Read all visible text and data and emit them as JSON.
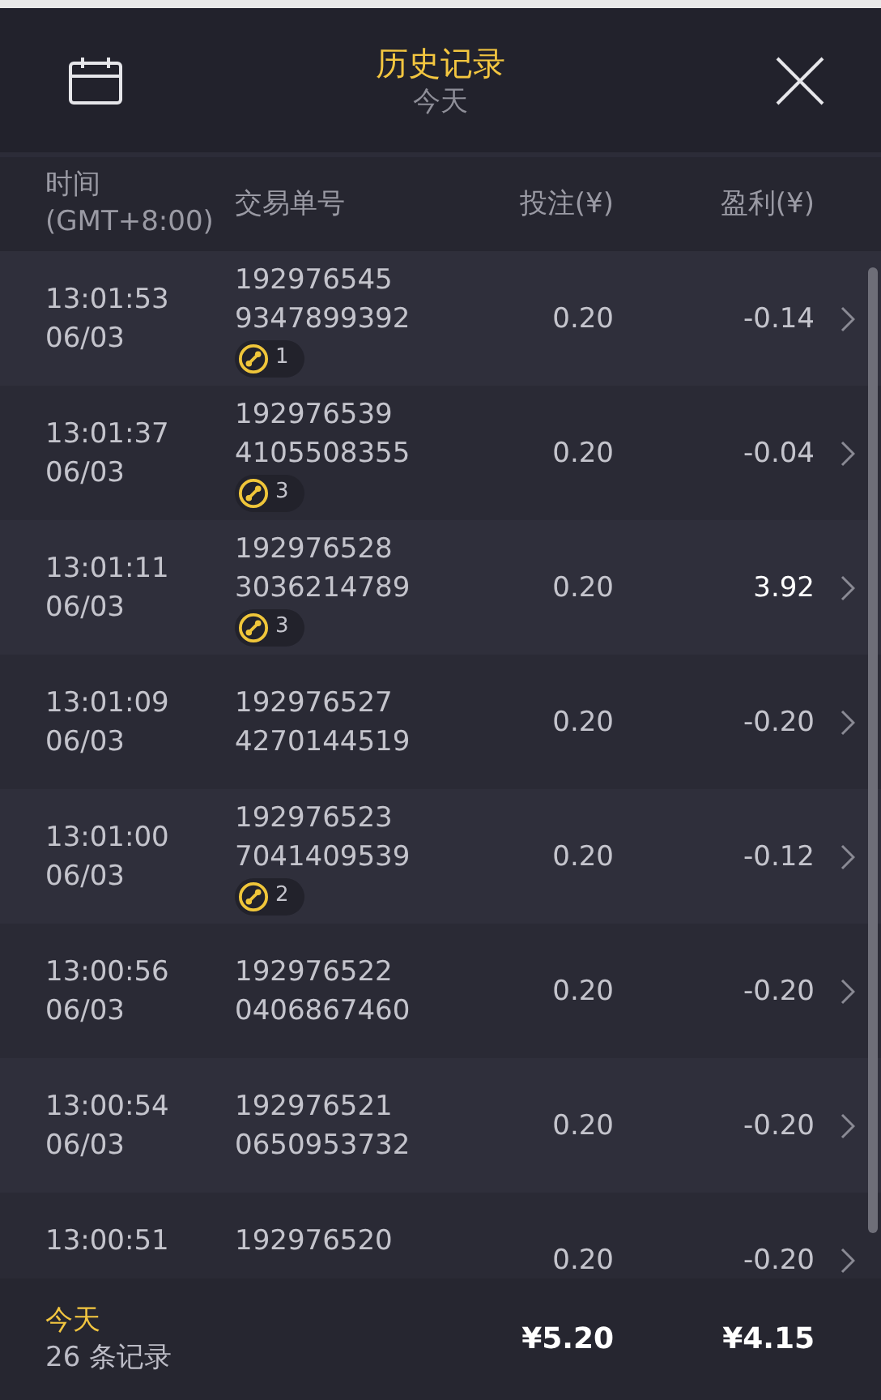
{
  "header": {
    "title": "历史记录",
    "subtitle": "今天"
  },
  "columns": [
    "时间\n(GMT+8:00)",
    "交易单号",
    "投注(¥)",
    "盈利(¥)"
  ],
  "rows": [
    {
      "time": "13:01:53",
      "date": "06/03",
      "order_1": "192976545",
      "order_2": "9347899392",
      "badge": "1",
      "stake": "0.20",
      "profit": "-0.14",
      "win": false
    },
    {
      "time": "13:01:37",
      "date": "06/03",
      "order_1": "192976539",
      "order_2": "4105508355",
      "badge": "3",
      "stake": "0.20",
      "profit": "-0.04",
      "win": false
    },
    {
      "time": "13:01:11",
      "date": "06/03",
      "order_1": "192976528",
      "order_2": "3036214789",
      "badge": "3",
      "stake": "0.20",
      "profit": "3.92",
      "win": true
    },
    {
      "time": "13:01:09",
      "date": "06/03",
      "order_1": "192976527",
      "order_2": "4270144519",
      "stake": "0.20",
      "profit": "-0.20",
      "win": false
    },
    {
      "time": "13:01:00",
      "date": "06/03",
      "order_1": "192976523",
      "order_2": "7041409539",
      "badge": "2",
      "stake": "0.20",
      "profit": "-0.12",
      "win": false
    },
    {
      "time": "13:00:56",
      "date": "06/03",
      "order_1": "192976522",
      "order_2": "0406867460",
      "stake": "0.20",
      "profit": "-0.20",
      "win": false
    },
    {
      "time": "13:00:54",
      "date": "06/03",
      "order_1": "192976521",
      "order_2": "0650953732",
      "stake": "0.20",
      "profit": "-0.20",
      "win": false
    },
    {
      "time": "13:00:51",
      "order_1": "192976520",
      "stake": "0.20",
      "profit": "-0.20",
      "win": false
    }
  ],
  "footer": {
    "period": "今天",
    "count": "26 条记录",
    "total_stake": "¥5.20",
    "total_profit": "¥4.15"
  }
}
